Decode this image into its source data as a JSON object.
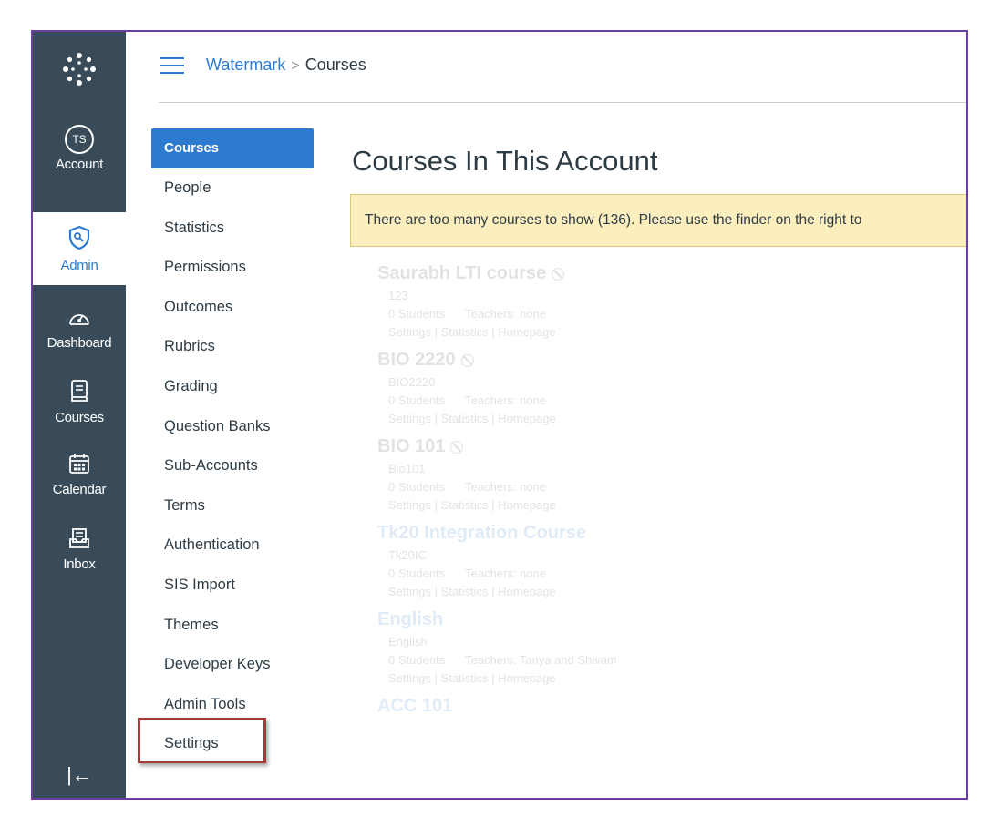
{
  "global_nav": {
    "items": [
      {
        "label": "Account",
        "icon": "avatar-icon",
        "avatar_initials": "TS"
      },
      {
        "label": "Admin",
        "icon": "shield-icon",
        "active": true
      },
      {
        "label": "Dashboard",
        "icon": "dashboard-icon"
      },
      {
        "label": "Courses",
        "icon": "book-icon"
      },
      {
        "label": "Calendar",
        "icon": "calendar-icon"
      },
      {
        "label": "Inbox",
        "icon": "inbox-icon"
      }
    ],
    "collapse_glyph": "|←"
  },
  "header": {
    "breadcrumb": {
      "link": "Watermark",
      "separator": ">",
      "current": "Courses"
    }
  },
  "section_nav": {
    "items": [
      "Courses",
      "People",
      "Statistics",
      "Permissions",
      "Outcomes",
      "Rubrics",
      "Grading",
      "Question Banks",
      "Sub-Accounts",
      "Terms",
      "Authentication",
      "SIS Import",
      "Themes",
      "Developer Keys",
      "Admin Tools",
      "Settings"
    ],
    "active_index": 0,
    "highlighted_item": "Settings"
  },
  "main": {
    "title": "Courses In This Account",
    "alert": "There are too many courses to show (136). Please use the finder on the right to",
    "courses": [
      {
        "name": "Saurabh LTI course",
        "published": false,
        "code": "123",
        "students": "0 Students",
        "teachers": "Teachers: none",
        "links": "Settings | Statistics | Homepage"
      },
      {
        "name": "BIO 2220",
        "published": false,
        "code": "BIO2220",
        "students": "0 Students",
        "teachers": "Teachers: none",
        "links": "Settings | Statistics | Homepage"
      },
      {
        "name": "BIO 101",
        "published": false,
        "code": "Bio101",
        "students": "0 Students",
        "teachers": "Teachers: none",
        "links": "Settings | Statistics | Homepage"
      },
      {
        "name": "Tk20 Integration Course",
        "published": true,
        "code": "Tk20IC",
        "students": "0 Students",
        "teachers": "Teachers: none",
        "links": "Settings | Statistics | Homepage"
      },
      {
        "name": "English",
        "published": true,
        "code": "English",
        "students": "0 Students",
        "teachers": "Teachers: Tanya and Shivam",
        "links": "Settings | Statistics | Homepage"
      },
      {
        "name": "ACC 101",
        "published": true
      }
    ]
  },
  "colors": {
    "nav_bg": "#394b58",
    "accent": "#2d7bd1",
    "alert_bg": "#fcefbd",
    "highlight_border": "#a53a3a",
    "frame_border": "#6b3fa0"
  }
}
